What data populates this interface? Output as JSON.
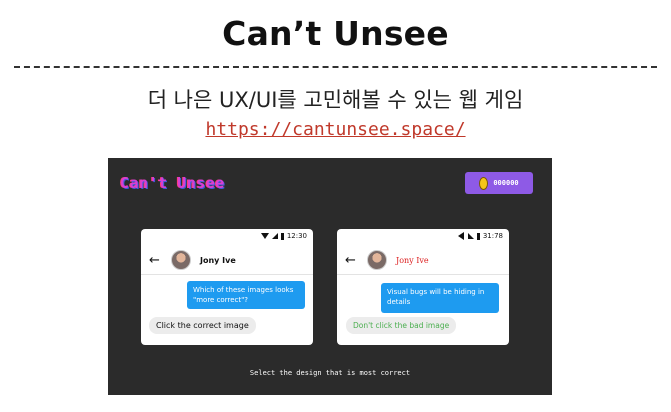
{
  "header": {
    "title": "Can’t Unsee",
    "subtitle": "더 나은 UX/UI를 고민해볼 수 있는 웹 게임",
    "url": "https://cantunsee.space/"
  },
  "game": {
    "logo": "Can't Unsee",
    "coin_count": "000000",
    "caption": "Select the design that is most correct",
    "colors": {
      "background": "#2b2b2b",
      "coin_badge": "#8e5ae6",
      "bubble_blue": "#1e9bf0",
      "wrong_name": "#d22222",
      "wrong_hint": "#4caf50"
    },
    "left_option": {
      "time": "12:30",
      "contact_name": "Jony Ive",
      "sent_message": "Which of these images looks \"more correct\"?",
      "received_message": "Click the correct image"
    },
    "right_option": {
      "time": "31:78",
      "contact_name": "Jony Ive",
      "sent_message": "Visual bugs will be hiding in details",
      "received_message": "Don't click the bad image"
    }
  },
  "icons": {
    "back": "arrow-left-icon",
    "coin": "coin-icon",
    "wifi": "wifi-icon",
    "signal": "signal-icon",
    "battery": "battery-icon"
  }
}
